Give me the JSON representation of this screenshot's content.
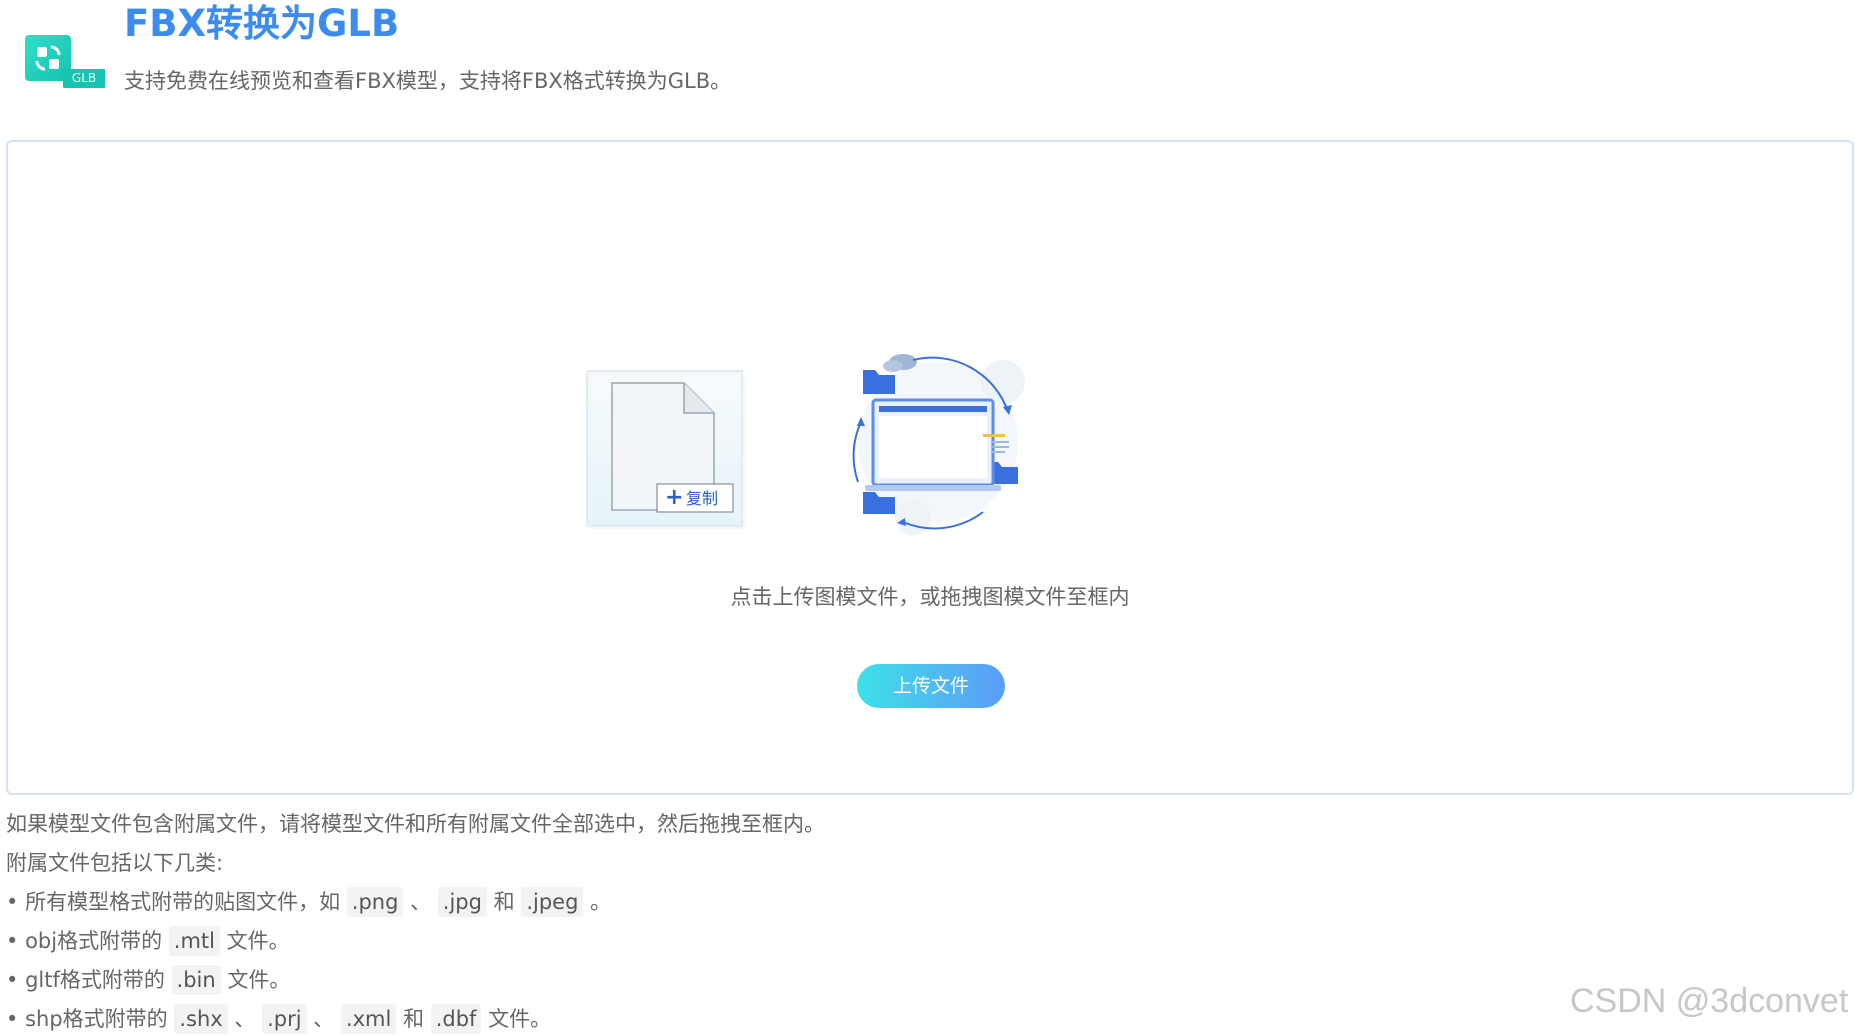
{
  "header": {
    "title": "FBX转换为GLB",
    "subtitle": "支持免费在线预览和查看FBX模型，支持将FBX格式转换为GLB。",
    "logo_badge": "GLB"
  },
  "dropzone": {
    "copy_label": "复制",
    "hint": "点击上传图模文件，或拖拽图模文件至框内",
    "upload_button": "上传文件"
  },
  "notes": {
    "line1": "如果模型文件包含附属文件，请将模型文件和所有附属文件全部选中，然后拖拽至框内。",
    "line2": "附属文件包括以下几类:",
    "item1": {
      "bullet": "•",
      "prefix": " 所有模型格式附带的贴图文件，如",
      "ext1": ".png",
      "sep1": "、",
      "ext2": ".jpg",
      "sep2": "和",
      "ext3": ".jpeg",
      "suffix": "。"
    },
    "item2": {
      "bullet": "•",
      "prefix": " obj格式附带的",
      "ext1": ".mtl",
      "suffix": "文件。"
    },
    "item3": {
      "bullet": "•",
      "prefix": " gltf格式附带的",
      "ext1": ".bin",
      "suffix": "文件。"
    },
    "item4": {
      "bullet": "•",
      "prefix": " shp格式附带的",
      "ext1": ".shx",
      "sep1": "、",
      "ext2": ".prj",
      "sep2": "、",
      "ext3": ".xml",
      "sep3": "和",
      "ext4": ".dbf",
      "suffix": "文件。"
    }
  },
  "watermark": "CSDN @3dconvet",
  "colors": {
    "title": "#3c8cf0",
    "logo": "#16c2b0",
    "button_start": "#3ee0e8",
    "button_end": "#5b9cf7",
    "dropzone_border": "#d5e2f2"
  }
}
